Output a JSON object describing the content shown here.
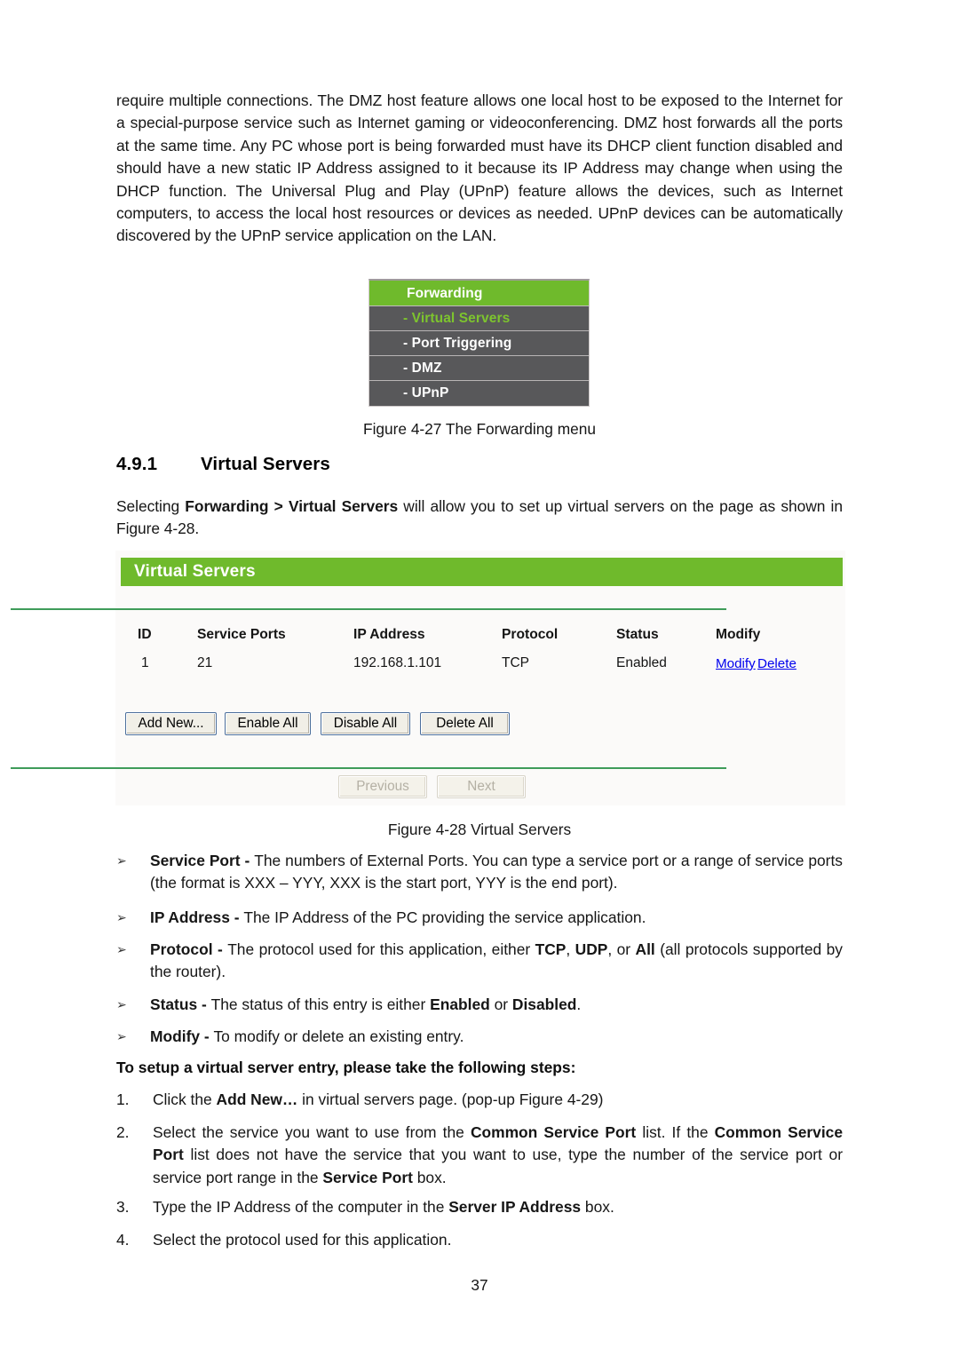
{
  "document": {
    "page_number": "37"
  },
  "intro": {
    "text": "require multiple connections. The DMZ host feature allows one local host to be exposed to the Internet for a special-purpose service such as Internet gaming or videoconferencing. DMZ host forwards all the ports at the same time. Any PC whose port is being forwarded must have its DHCP client function disabled and should have a new static IP Address assigned to it because its IP Address may change when using the DHCP function. The Universal Plug and Play (UPnP) feature allows the devices, such as Internet computers, to access the local host resources or devices as needed. UPnP devices can be automatically discovered by the UPnP service application on the LAN."
  },
  "forwarding_menu": {
    "header": "Forwarding",
    "items": [
      {
        "label": "- Virtual Servers",
        "selected": true
      },
      {
        "label": "- Port Triggering",
        "selected": false
      },
      {
        "label": "- DMZ",
        "selected": false
      },
      {
        "label": "- UPnP",
        "selected": false
      }
    ],
    "header_color": "#6fba2c",
    "item_background": "#58585a",
    "selected_text_color": "#7dc42e"
  },
  "captions": {
    "figure_4_27": "Figure 4-27 The Forwarding menu",
    "figure_4_28": "Figure 4-28 Virtual Servers"
  },
  "section": {
    "number": "4.9.1",
    "title": "Virtual Servers",
    "intro_prefix": "Selecting ",
    "intro_bold": "Forwarding > Virtual Servers",
    "intro_suffix": " will allow you to set up virtual servers on the page as shown in Figure 4-28."
  },
  "virtual_servers_panel": {
    "title": "Virtual Servers",
    "table": {
      "columns": [
        "ID",
        "Service Ports",
        "IP Address",
        "Protocol",
        "Status",
        "Modify"
      ],
      "rows": [
        {
          "id": "1",
          "service_ports": "21",
          "ip_address": "192.168.1.101",
          "protocol": "TCP",
          "status": "Enabled",
          "modify_link": "Modify",
          "delete_link": "Delete"
        }
      ]
    },
    "action_buttons": [
      {
        "label": "Add New...",
        "disabled": false
      },
      {
        "label": "Enable All",
        "disabled": false
      },
      {
        "label": "Disable All",
        "disabled": false
      },
      {
        "label": "Delete All",
        "disabled": false
      }
    ],
    "pagination_buttons": [
      {
        "label": "Previous",
        "disabled": true
      },
      {
        "label": "Next",
        "disabled": true
      }
    ],
    "header_color": "#6fba2c",
    "rule_color": "#3f9c5a",
    "link_color": "#0000ee"
  },
  "bullets": [
    {
      "marker": "➢",
      "bold": "Service Port - ",
      "text": "The numbers of External Ports. You can type a service port or a range of service ports (the format is XXX – YYY, XXX is the start port, YYY is the end port)."
    },
    {
      "marker": "➢",
      "bold": "IP Address - ",
      "text": "The IP Address of the PC providing the service application."
    },
    {
      "marker": "➢",
      "bold": "Protocol - ",
      "text": "The protocol used for this application, either TCP, UDP, or All (all protocols supported by the router)."
    },
    {
      "marker": "➢",
      "bold": "Status - ",
      "text": "The status of this entry is either Enabled or Disabled."
    },
    {
      "marker": "➢",
      "bold": "Modify - ",
      "text": "To modify or delete an existing entry."
    }
  ],
  "steps": {
    "heading": "To setup a virtual server entry, please take the following steps:",
    "items": [
      {
        "num": "1.",
        "text": "Click the Add New… in virtual servers page. (pop-up Figure 4-29)"
      },
      {
        "num": "2.",
        "text": "Select the service you want to use from the Common Service Port list. If the Common Service Port list does not have the service that you want to use, type the number of the service port or service port range in the Service Port box."
      },
      {
        "num": "3.",
        "text": "Type the IP Address of the computer in the Server IP Address box."
      },
      {
        "num": "4.",
        "text": "Select the protocol used for this application."
      }
    ]
  }
}
